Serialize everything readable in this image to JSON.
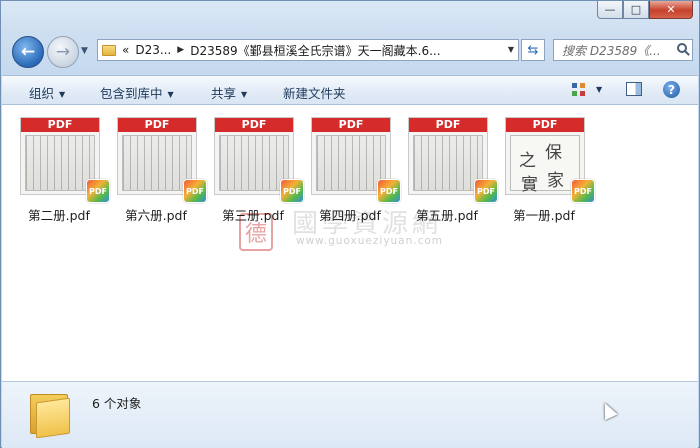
{
  "window": {
    "caption_buttons": {
      "minimize": "—",
      "maximize": "□",
      "close": "✕"
    }
  },
  "nav": {
    "back_icon": "←",
    "forward_icon": "→",
    "history_dropdown_icon": "▼"
  },
  "address_bar": {
    "overflow": "«",
    "crumbs": [
      "D23...",
      "D23589《鄞县桓溪全氏宗谱》天一阁藏本.6..."
    ],
    "separator": "▶",
    "dropdown_icon": "▼"
  },
  "refresh_icon": "⇆",
  "search": {
    "placeholder": "搜索 D23589《..."
  },
  "toolbar": {
    "organize": "组织",
    "include_library": "包含到库中",
    "share": "共享",
    "new_folder": "新建文件夹",
    "caret": "▼",
    "help": "?"
  },
  "files": [
    {
      "name": "第二册.pdf",
      "thumb_band": "PDF",
      "badge": "PDF"
    },
    {
      "name": "第六册.pdf",
      "thumb_band": "PDF",
      "badge": "PDF"
    },
    {
      "name": "第三册.pdf",
      "thumb_band": "PDF",
      "badge": "PDF"
    },
    {
      "name": "第四册.pdf",
      "thumb_band": "PDF",
      "badge": "PDF"
    },
    {
      "name": "第五册.pdf",
      "thumb_band": "PDF",
      "badge": "PDF"
    },
    {
      "name": "第一册.pdf",
      "thumb_band": "PDF",
      "badge": "PDF",
      "script_chars": [
        "之",
        "保",
        "實",
        "家"
      ]
    }
  ],
  "watermark": {
    "seal": "德",
    "text": "國學資源網",
    "url": "www.guoxueziyuan.com"
  },
  "status": {
    "count_text": "6 个对象"
  }
}
